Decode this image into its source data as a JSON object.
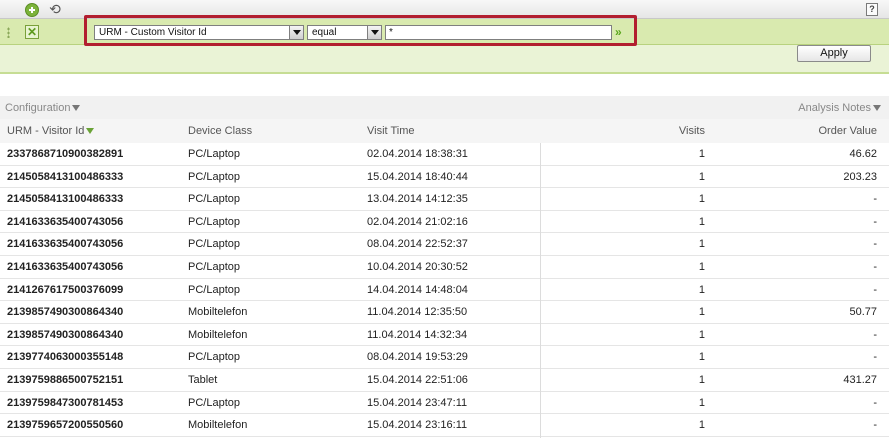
{
  "filter": {
    "field_value": "URM - Custom Visitor Id",
    "operator_value": "equal",
    "input_value": "*",
    "apply_label": "Apply",
    "help_label": "?",
    "go_label": "»",
    "remove_label": "✕"
  },
  "table": {
    "config_label": "Configuration",
    "notes_label": "Analysis Notes",
    "columns": [
      "URM - Visitor Id",
      "Device Class",
      "Visit Time",
      "Visits",
      "Order Value"
    ],
    "rows": [
      [
        "2337868710900382891",
        "PC/Laptop",
        "02.04.2014 18:38:31",
        "1",
        "46.62"
      ],
      [
        "2145058413100486333",
        "PC/Laptop",
        "15.04.2014 18:40:44",
        "1",
        "203.23"
      ],
      [
        "2145058413100486333",
        "PC/Laptop",
        "13.04.2014 14:12:35",
        "1",
        "-"
      ],
      [
        "2141633635400743056",
        "PC/Laptop",
        "02.04.2014 21:02:16",
        "1",
        "-"
      ],
      [
        "2141633635400743056",
        "PC/Laptop",
        "08.04.2014 22:52:37",
        "1",
        "-"
      ],
      [
        "2141633635400743056",
        "PC/Laptop",
        "10.04.2014 20:30:52",
        "1",
        "-"
      ],
      [
        "2141267617500376099",
        "PC/Laptop",
        "14.04.2014 14:48:04",
        "1",
        "-"
      ],
      [
        "2139857490300864340",
        "Mobiltelefon",
        "11.04.2014 12:35:50",
        "1",
        "50.77"
      ],
      [
        "2139857490300864340",
        "Mobiltelefon",
        "11.04.2014 14:32:34",
        "1",
        "-"
      ],
      [
        "2139774063000355148",
        "PC/Laptop",
        "08.04.2014 19:53:29",
        "1",
        "-"
      ],
      [
        "2139759886500752151",
        "Tablet",
        "15.04.2014 22:51:06",
        "1",
        "431.27"
      ],
      [
        "2139759847300781453",
        "PC/Laptop",
        "15.04.2014 23:47:11",
        "1",
        "-"
      ],
      [
        "2139759657200550560",
        "Mobiltelefon",
        "15.04.2014 23:16:11",
        "1",
        "-"
      ]
    ]
  }
}
